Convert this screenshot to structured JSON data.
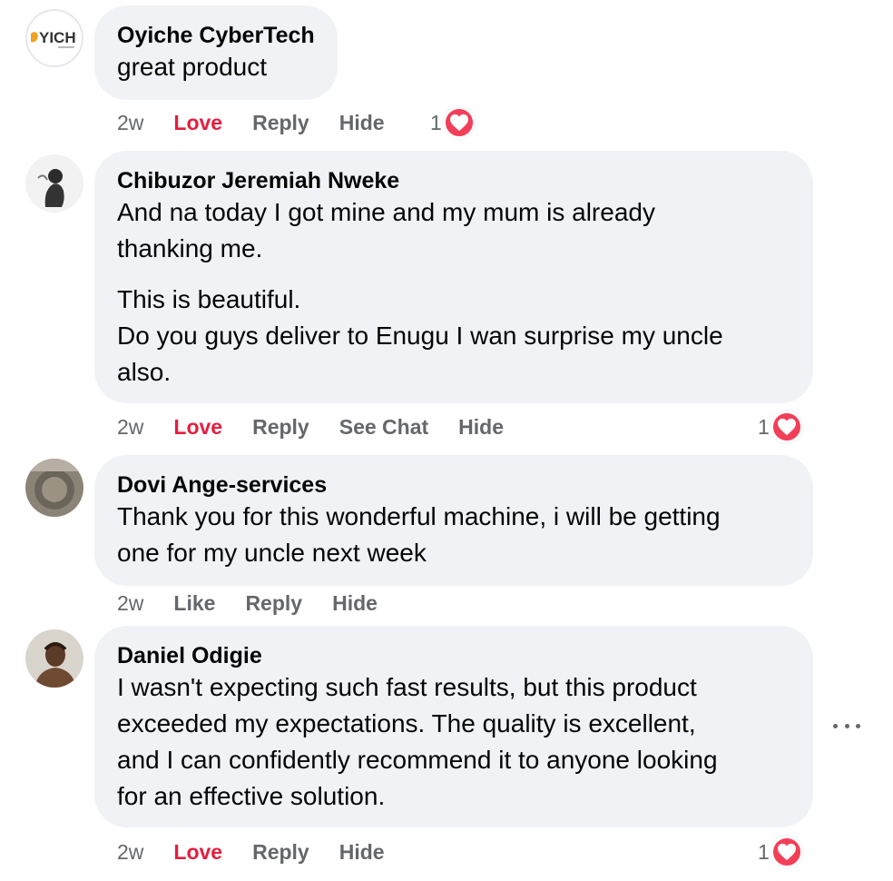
{
  "comments": [
    {
      "author": "Oyiche CyberTech",
      "avatar": "oyiche-logo-avatar",
      "avatar_text": "YICH",
      "paragraphs": [
        "great product"
      ],
      "actions": {
        "time": "2w",
        "react": "Love",
        "reply": "Reply",
        "extra": "",
        "hide": "Hide"
      },
      "reaction_count": "1",
      "reaction_icon": "heart-icon"
    },
    {
      "author": "Chibuzor Jeremiah Nweke",
      "avatar": "person-silhouette-avatar",
      "paragraphs": [
        "And na today I got mine and my mum is already thanking me.",
        "This is beautiful.\nDo you guys deliver to Enugu I wan surprise my uncle also."
      ],
      "paragraph_lines": [
        [
          "And na today I got mine and my mum is already",
          "thanking me."
        ],
        [
          "This is beautiful.",
          "Do you guys deliver to Enugu I wan surprise my uncle",
          "also."
        ]
      ],
      "actions": {
        "time": "2w",
        "react": "Love",
        "reply": "Reply",
        "extra": "See Chat",
        "hide": "Hide"
      },
      "reaction_count": "1",
      "reaction_icon": "heart-icon"
    },
    {
      "author": "Dovi Ange-services",
      "avatar": "profile-photo-avatar",
      "paragraph_lines": [
        [
          "Thank you for this wonderful machine, i will be getting",
          "one for my uncle next week"
        ]
      ],
      "actions": {
        "time": "2w",
        "react": "Like",
        "reply": "Reply",
        "extra": "",
        "hide": "Hide"
      },
      "reaction_count": "",
      "reaction_icon": ""
    },
    {
      "author": "Daniel Odigie",
      "avatar": "profile-photo-avatar",
      "paragraph_lines": [
        [
          "I wasn't expecting such fast results, but this product",
          "exceeded my expectations. The quality is excellent,",
          "and I can confidently recommend it to anyone looking",
          "for an effective solution."
        ]
      ],
      "actions": {
        "time": "2w",
        "react": "Love",
        "reply": "Reply",
        "extra": "",
        "hide": "Hide"
      },
      "reaction_count": "1",
      "reaction_icon": "heart-icon"
    }
  ],
  "more_menu": {
    "icon": "more-options-icon"
  },
  "colors": {
    "bubble": "#f0f2f5",
    "love": "#e41e3f",
    "heart_badge": "#f33e58",
    "muted": "#65676b"
  }
}
